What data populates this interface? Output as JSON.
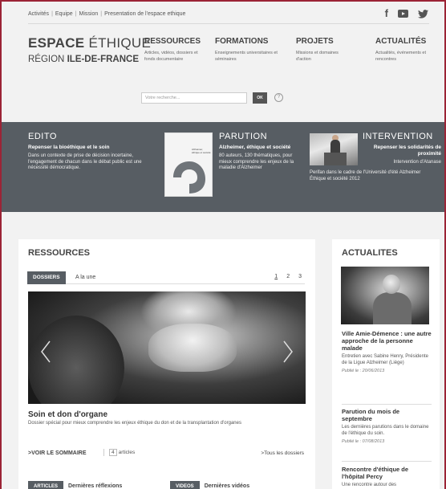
{
  "topbar": {
    "links": [
      "Activités",
      "Equipe",
      "Mission",
      "Presentation de l'espace ethique"
    ],
    "social": [
      "facebook-icon",
      "youtube-icon",
      "twitter-icon"
    ]
  },
  "logo": {
    "line1_bold": "ESPACE",
    "line1_rest": " ÉTHIQUE",
    "line2_rest": "RÉGION ",
    "line2_bold": "ILE-DE-FRANCE"
  },
  "nav": [
    {
      "title": "RESSOURCES",
      "desc": "Articles, vidéos, dossiers et fonds documentaire"
    },
    {
      "title": "FORMATIONS",
      "desc": "Enseignements universitaires et séminaires"
    },
    {
      "title": "PROJETS",
      "desc": "Missions et domaines d'action"
    },
    {
      "title": "ACTUALITÉS",
      "desc": "Actualités, événements et rencontres"
    }
  ],
  "search": {
    "placeholder": "Votre recherche...",
    "button": "OK",
    "help": "?"
  },
  "band": {
    "edito": {
      "heading": "EDITO",
      "subtitle": "Repenser la bioéthique et le soin",
      "text": "Dans un contexte de prise de décision incertaine, l'engagement de chacun dans le débat public est une nécessité démocratique."
    },
    "parution": {
      "heading": "PARUTION",
      "subtitle": "Alzheimer, éthique et société",
      "text": "80 auteurs, 130 thématiques, pour mieux comprendre les enjeux de la maladie d'Alzheimer",
      "cover_title": "Alzheimer, éthique et société"
    },
    "intervention": {
      "heading": "INTERVENTION",
      "subtitle": "Repenser les solidarités de proximité",
      "text_right": "Intervention d'Atanase",
      "text": "Perifan dans le cadre de l'Université d'été Alzheimer Éthique et société 2012"
    }
  },
  "ressources": {
    "title": "RESSOURCES",
    "tab": "DOSSIERS",
    "tab_label": "A la une",
    "pages": [
      "1",
      "2",
      "3"
    ],
    "hero_title": "Soin et don d'organe",
    "hero_desc": "Dossier spécial pour mieux comprendre les enjeux éthique du don et de la transplantation d'organes",
    "voir": ">VOIR LE SOMMAIRE",
    "count": "4",
    "count_label": "articles",
    "tous": ">Tous les dossiers",
    "sub1_tab": "ARTICLES",
    "sub1_label": "Dernières réflexions",
    "sub2_tab": "VIDEOS",
    "sub2_label": "Dernières vidéos"
  },
  "actualites": {
    "title": "ACTUALITES",
    "items": [
      {
        "title": "Ville Amie-Démence : une autre approche de la personne malade",
        "desc": "Entretien avec Sabine Henry, Présidente de la Ligue Alzheimer (Liège)",
        "date": "Publié le : 20/06/2013"
      },
      {
        "title": "Parution du mois de septembre",
        "desc": "Les dernières parutions dans le domaine de l'éthique du soin.",
        "date": "Publié le : 07/08/2013"
      },
      {
        "title": "Rencontre d'éthique de l'hôpital Percy",
        "desc": "Une rencontre autour des",
        "date": ""
      }
    ]
  }
}
